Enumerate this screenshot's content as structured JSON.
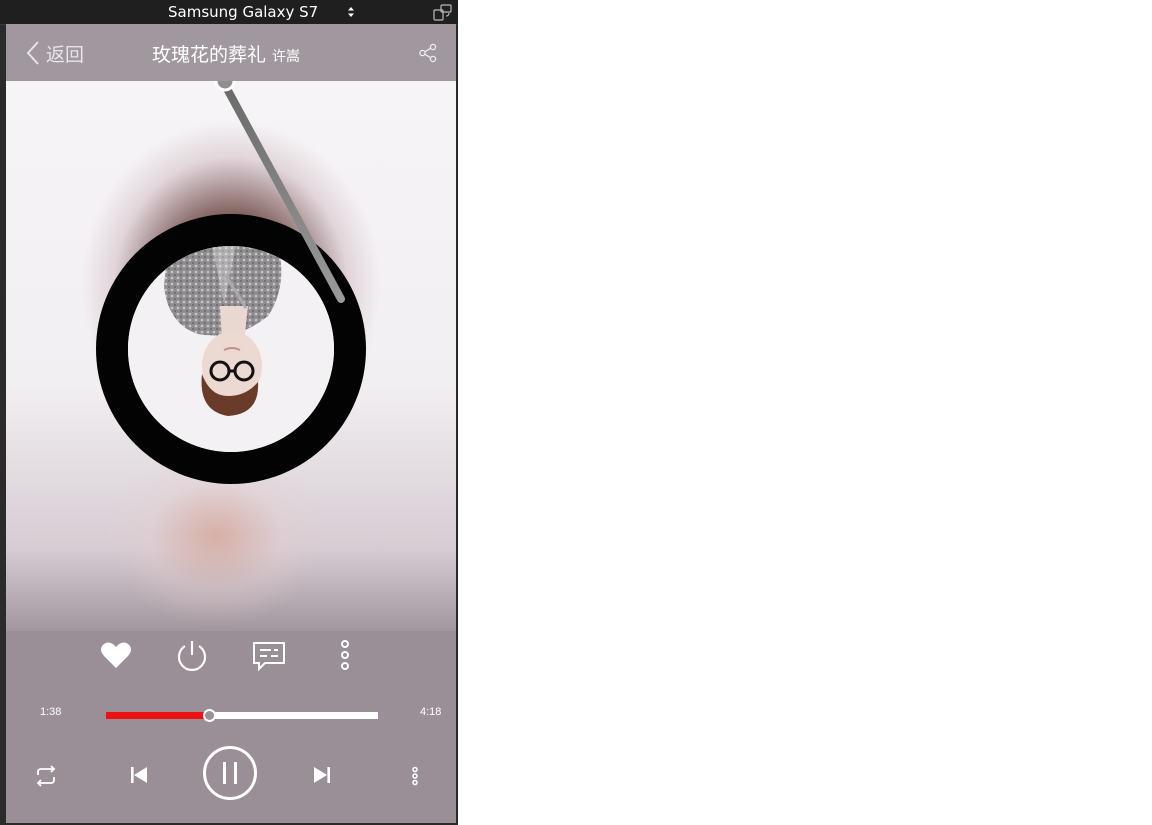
{
  "device": {
    "name": "Samsung Galaxy S7"
  },
  "header": {
    "back_label": "返回",
    "song_title": "玫瑰花的葬礼",
    "artist": "许嵩"
  },
  "player": {
    "elapsed": "1:38",
    "duration": "4:18",
    "progress_fraction": 0.38,
    "state": "playing"
  },
  "icons": {
    "back": "chevron-left-icon",
    "share": "share-icon",
    "like": "heart-icon",
    "sleep_timer": "power-icon",
    "comments": "comment-icon",
    "more_actions": "more-vertical-icon",
    "repeat": "repeat-icon",
    "previous": "skip-previous-icon",
    "pause": "pause-icon",
    "next": "skip-next-icon",
    "playlist": "more-vertical-icon"
  },
  "colors": {
    "accent": "#ee1111",
    "bar_background": "#9a8f97",
    "foreground": "#ffffff"
  }
}
